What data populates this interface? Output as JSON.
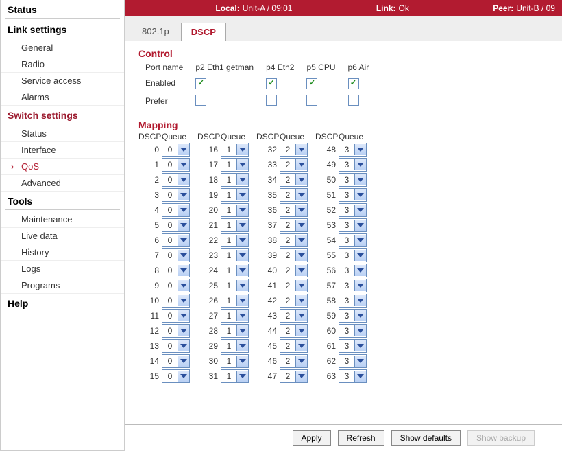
{
  "topbar": {
    "local_label": "Local:",
    "local_value": "Unit-A / 09:01",
    "link_label": "Link:",
    "link_value": "Ok",
    "peer_label": "Peer:",
    "peer_value": "Unit-B / 09"
  },
  "sidebar": {
    "groups": [
      {
        "title": "Status",
        "items": []
      },
      {
        "title": "Link settings",
        "items": [
          "General",
          "Radio",
          "Service access",
          "Alarms"
        ]
      },
      {
        "title": "Switch settings",
        "highlight": true,
        "items": [
          "Status",
          "Interface",
          "QoS",
          "Advanced"
        ],
        "active_index": 2
      },
      {
        "title": "Tools",
        "items": [
          "Maintenance",
          "Live data",
          "History",
          "Logs",
          "Programs"
        ]
      },
      {
        "title": "Help",
        "items": []
      }
    ]
  },
  "tabs": {
    "items": [
      "802.1p",
      "DSCP"
    ],
    "active": 1
  },
  "control": {
    "title": "Control",
    "port_name_label": "Port name",
    "ports": [
      "p2 Eth1 getman",
      "p4 Eth2",
      "p5 CPU",
      "p6 Air"
    ],
    "rows": [
      {
        "label": "Enabled",
        "values": [
          true,
          true,
          true,
          true
        ]
      },
      {
        "label": "Prefer",
        "values": [
          false,
          false,
          false,
          false
        ]
      }
    ]
  },
  "mapping": {
    "title": "Mapping",
    "column_headers": {
      "dscp": "DSCP",
      "queue": "Queue"
    },
    "columns": [
      {
        "start": 0,
        "queue": "0"
      },
      {
        "start": 16,
        "queue": "1"
      },
      {
        "start": 32,
        "queue": "2"
      },
      {
        "start": 48,
        "queue": "3"
      }
    ],
    "rows_per_col": 16
  },
  "footer": {
    "apply": "Apply",
    "refresh": "Refresh",
    "show_defaults": "Show defaults",
    "show_backup": "Show backup"
  }
}
